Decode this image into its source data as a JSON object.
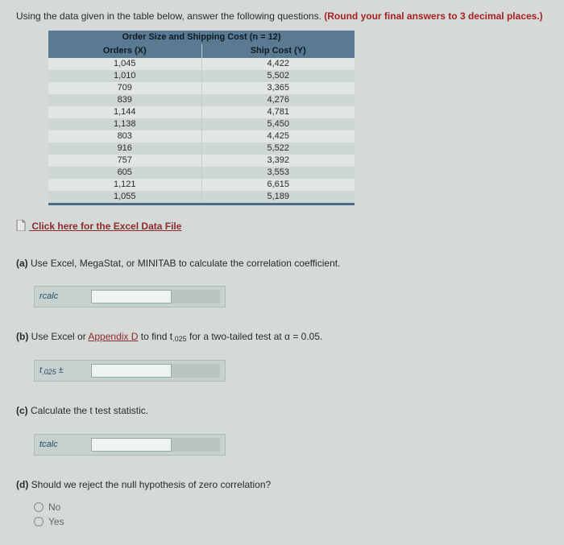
{
  "intro": {
    "line1": "Using the data given in the table below, answer the following questions.",
    "round_note": "(Round your final answers to 3 decimal places.)"
  },
  "table": {
    "title": "Order Size and Shipping Cost (n = 12)",
    "col_x": "Orders (X)",
    "col_y": "Ship Cost (Y)",
    "rows": [
      {
        "x": "1,045",
        "y": "4,422"
      },
      {
        "x": "1,010",
        "y": "5,502"
      },
      {
        "x": "709",
        "y": "3,365"
      },
      {
        "x": "839",
        "y": "4,276"
      },
      {
        "x": "1,144",
        "y": "4,781"
      },
      {
        "x": "1,138",
        "y": "5,450"
      },
      {
        "x": "803",
        "y": "4,425"
      },
      {
        "x": "916",
        "y": "5,522"
      },
      {
        "x": "757",
        "y": "3,392"
      },
      {
        "x": "605",
        "y": "3,553"
      },
      {
        "x": "1,121",
        "y": "6,615"
      },
      {
        "x": "1,055",
        "y": "5,189"
      }
    ]
  },
  "excel_link": "Click here for the Excel Data File",
  "parts": {
    "a": {
      "prefix": "(a)",
      "text": "Use Excel, MegaStat, or MINITAB to calculate the correlation coefficient.",
      "label": "rcalc",
      "value": ""
    },
    "b": {
      "prefix": "(b)",
      "pre": "Use Excel or ",
      "appendix": "Appendix D",
      "mid": " to find t",
      "sub1": ".025",
      "post1": " for a two-tailed test at α = 0.05.",
      "label_base": "t",
      "label_sub": ".025",
      "label_suffix": " ±",
      "value": ""
    },
    "c": {
      "prefix": "(c)",
      "text": "Calculate the t test statistic.",
      "label": "tcalc",
      "value": ""
    },
    "d": {
      "prefix": "(d)",
      "text": "Should we reject the null hypothesis of zero correlation?",
      "opt_no": "No",
      "opt_yes": "Yes"
    }
  }
}
